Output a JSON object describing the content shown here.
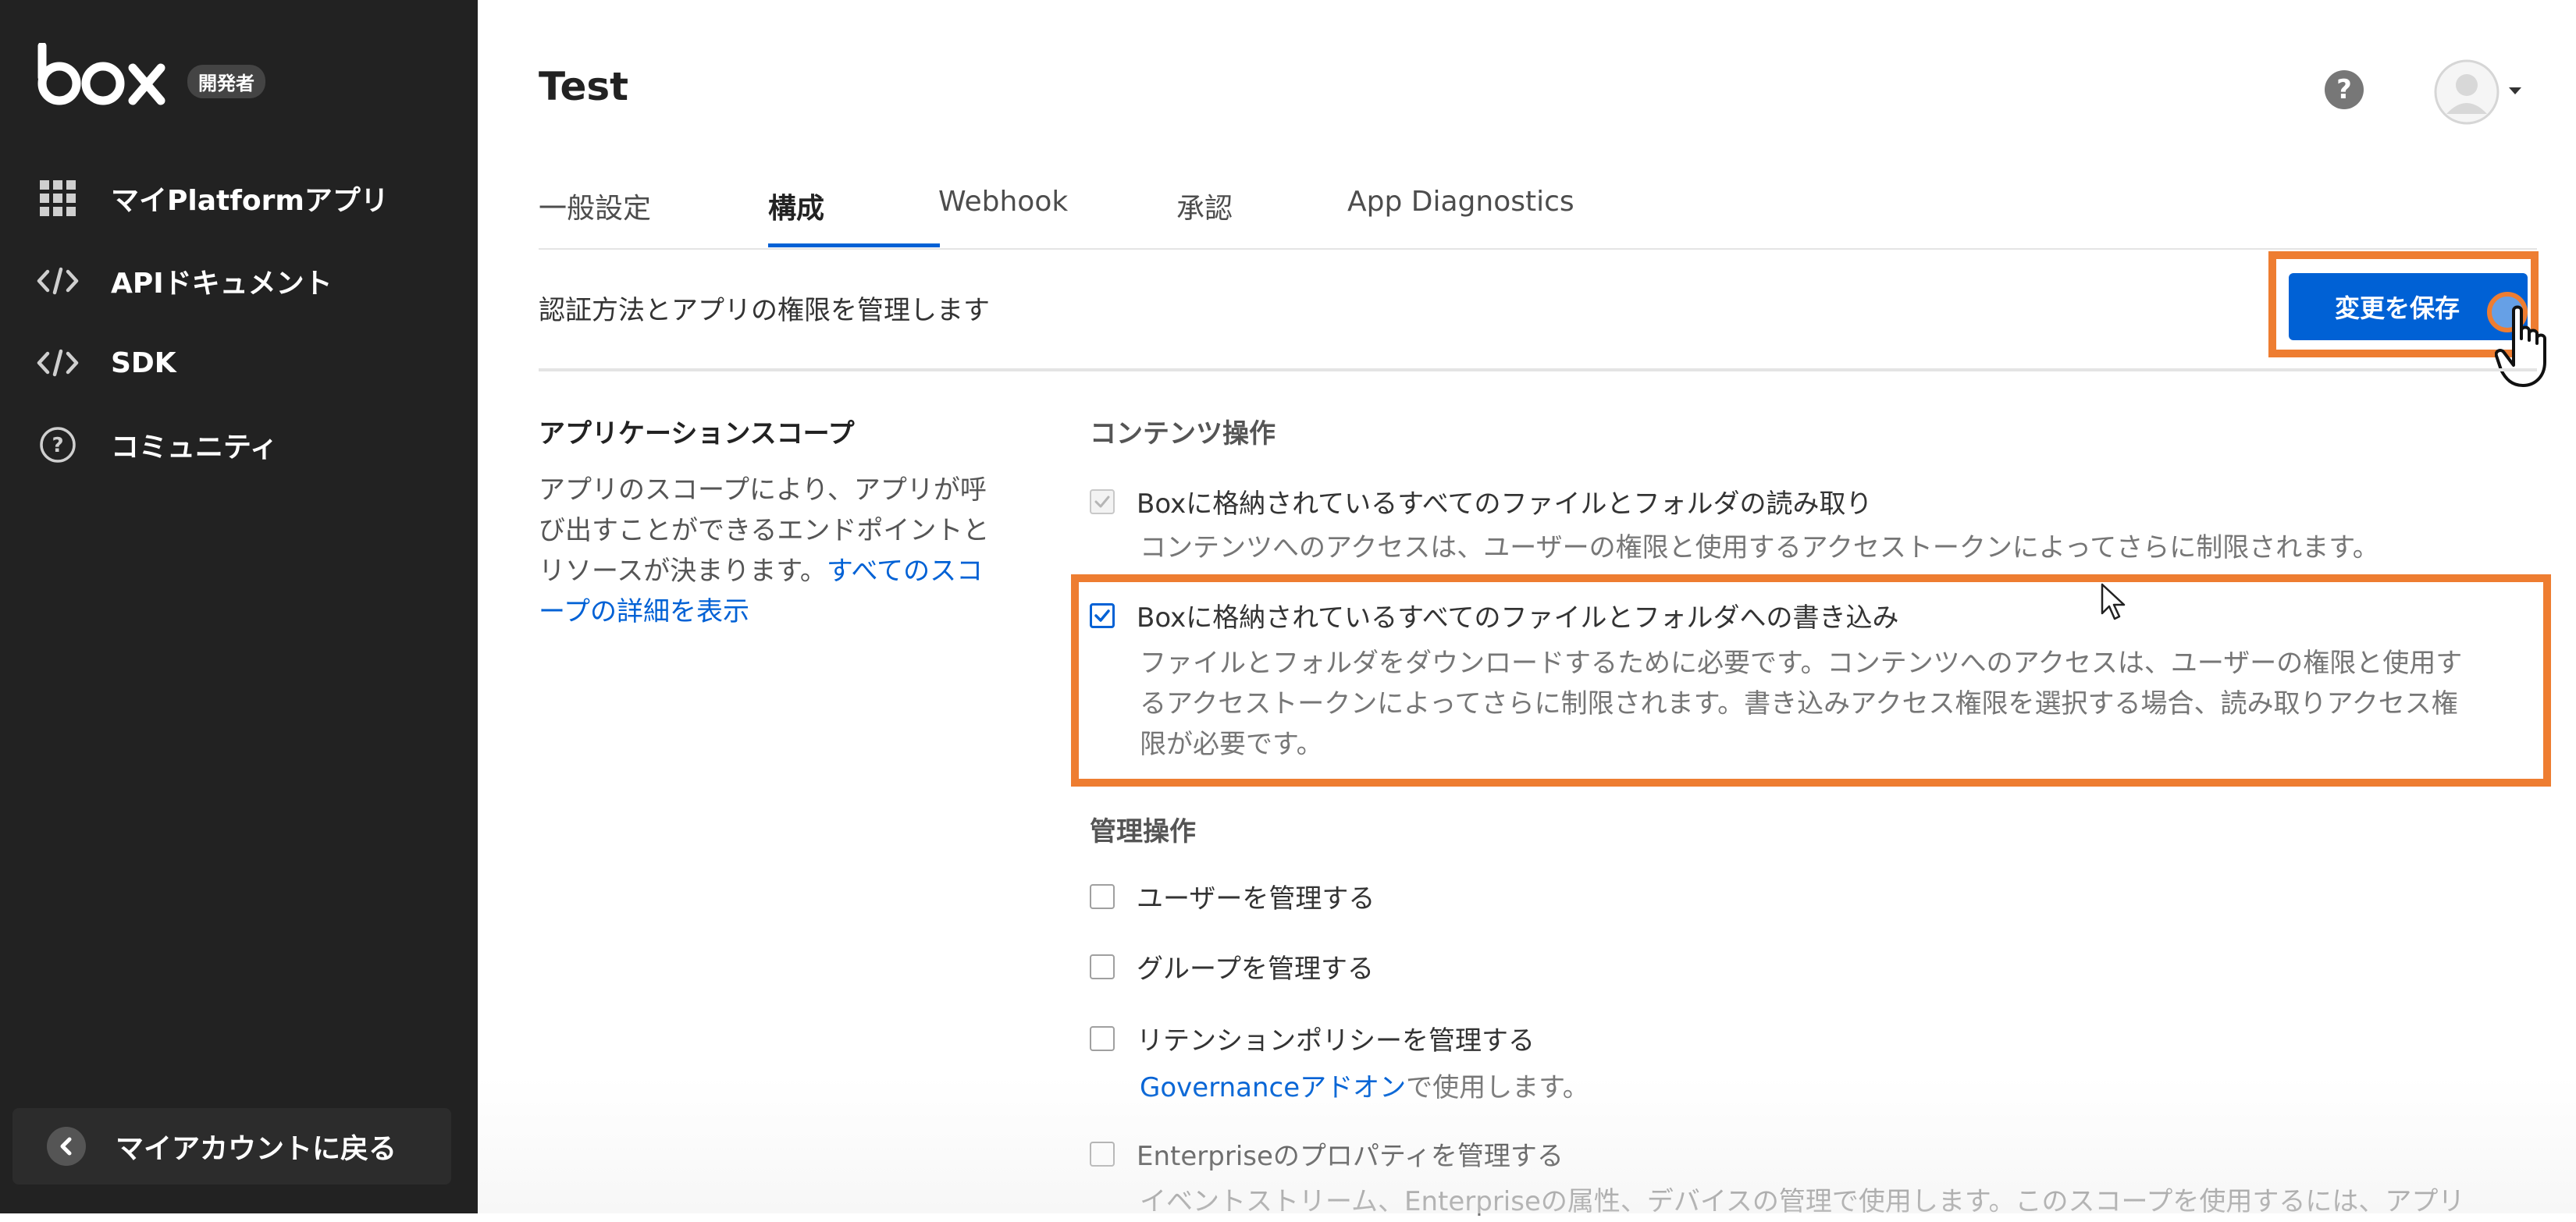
{
  "sidebar": {
    "logo_text": "box",
    "badge": "開発者",
    "items": [
      {
        "label": "マイPlatformアプリ",
        "icon": "grid-icon"
      },
      {
        "label": "APIドキュメント",
        "icon": "code-icon"
      },
      {
        "label": "SDK",
        "icon": "code-icon"
      },
      {
        "label": "コミュニティ",
        "icon": "help-circle-icon"
      }
    ],
    "back_label": "マイアカウントに戻る"
  },
  "header": {
    "app_title": "Test",
    "help_label": "?"
  },
  "tabs": [
    {
      "label": "一般設定"
    },
    {
      "label": "構成",
      "active": true
    },
    {
      "label": "Webhook"
    },
    {
      "label": "承認"
    },
    {
      "label": "App Diagnostics"
    }
  ],
  "toolbar": {
    "subtitle": "認証方法とアプリの権限を管理します",
    "save_label": "変更を保存"
  },
  "scopes": {
    "title": "アプリケーションスコープ",
    "description": "アプリのスコープにより、アプリが呼び出すことができるエンドポイントとリソースが決まります。",
    "link": "すべてのスコープの詳細を表示"
  },
  "content_ops": {
    "title": "コンテンツ操作",
    "read": {
      "label": "Boxに格納されているすべてのファイルとフォルダの読み取り",
      "desc": "コンテンツへのアクセスは、ユーザーの権限と使用するアクセストークンによってさらに制限されます。",
      "checked": true,
      "disabled": true
    },
    "write": {
      "label": "Boxに格納されているすべてのファイルとフォルダへの書き込み",
      "desc_lines": [
        "ファイルとフォルダをダウンロードするために必要です。コンテンツへのアクセスは、ユーザーの権限と使用す",
        "るアクセストークンによってさらに制限されます。書き込みアクセス権限を選択する場合、読み取りアクセス権",
        "限が必要です。"
      ],
      "checked": true
    }
  },
  "admin_ops": {
    "title": "管理操作",
    "items": [
      {
        "label": "ユーザーを管理する",
        "checked": false
      },
      {
        "label": "グループを管理する",
        "checked": false
      },
      {
        "label": "リテンションポリシーを管理する",
        "checked": false,
        "desc_link": "Governanceアドオン",
        "desc_suffix": "で使用します。"
      },
      {
        "label": "Enterpriseのプロパティを管理する",
        "checked": false,
        "desc": "イベントストリーム、Enterpriseの属性、デバイスの管理で使用します。このスコープを使用するには、アプリ"
      }
    ]
  },
  "colors": {
    "sidebar_bg": "#222222",
    "accent_blue": "#0061d5",
    "highlight_orange": "#ee7d31"
  }
}
